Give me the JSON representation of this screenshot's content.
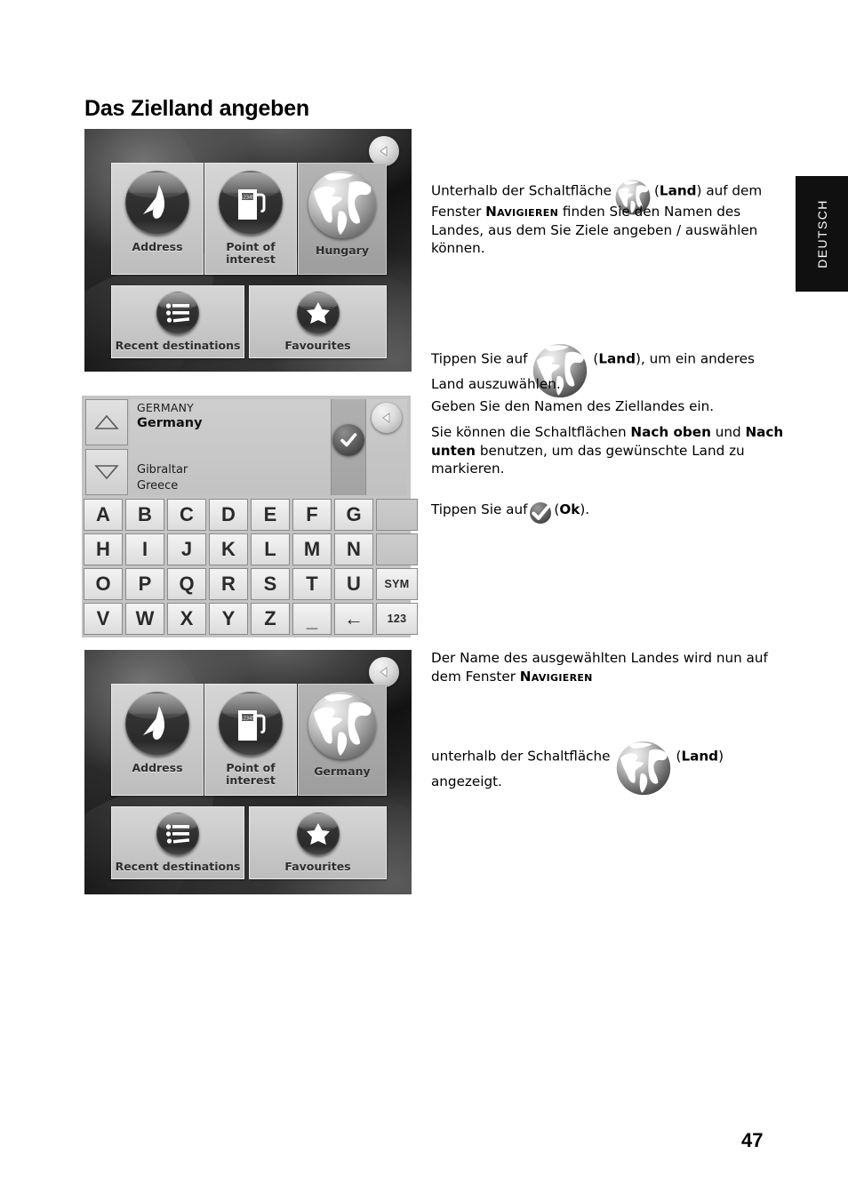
{
  "page": {
    "heading": "Das Zielland angeben",
    "number": "47",
    "language_tab": "DEUTSCH"
  },
  "screenshot_navigate_hungary": {
    "name": "NAVIGIEREN",
    "back_icon": "back-arrow-icon",
    "tiles": [
      {
        "label": "Address",
        "icon": "compass-needle-icon"
      },
      {
        "label": "Point of interest",
        "icon": "fuel-pump-icon"
      },
      {
        "label": "Hungary",
        "icon": "globe-icon"
      },
      {
        "label": "Recent destinations",
        "icon": "list-icon"
      },
      {
        "label": "Favourites",
        "icon": "star-icon"
      }
    ]
  },
  "screenshot_country_picker": {
    "typed_text": "GERMANY",
    "selected_country": "Germany",
    "list_items": [
      "Gibraltar",
      "Greece"
    ],
    "up_button_icon": "triangle-up-icon",
    "down_button_icon": "triangle-down-icon",
    "ok_button_icon": "check-icon",
    "back_icon": "back-arrow-icon",
    "keyboard": {
      "rows": [
        [
          "A",
          "B",
          "C",
          "D",
          "E",
          "F",
          "G",
          ""
        ],
        [
          "H",
          "I",
          "J",
          "K",
          "L",
          "M",
          "N",
          ""
        ],
        [
          "O",
          "P",
          "Q",
          "R",
          "S",
          "T",
          "U",
          "SYM"
        ],
        [
          "V",
          "W",
          "X",
          "Y",
          "Z",
          "_",
          "←",
          "123"
        ]
      ]
    }
  },
  "screenshot_navigate_germany": {
    "name": "NAVIGIEREN",
    "back_icon": "back-arrow-icon",
    "tiles": [
      {
        "label": "Address",
        "icon": "compass-needle-icon"
      },
      {
        "label": "Point of interest",
        "icon": "fuel-pump-icon"
      },
      {
        "label": "Germany",
        "icon": "globe-icon"
      },
      {
        "label": "Recent destinations",
        "icon": "list-icon"
      },
      {
        "label": "Favourites",
        "icon": "star-icon"
      }
    ]
  },
  "body": {
    "p1": {
      "a": "Unterhalb der Schaltfläche",
      "bold1": "Land",
      "b": "auf dem Fenster",
      "sc1": "Navigieren",
      "c": "finden Sie den Namen des Landes, aus dem Sie Ziele angeben / auswählen können."
    },
    "p2": {
      "a": "Tippen Sie auf",
      "bold1": "Land",
      "b": "), um ein anderes Land auszuwählen."
    },
    "p3": "Geben Sie den Namen des Ziellandes ein.",
    "p4": {
      "a": "Sie können die Schaltflächen",
      "bold1": "Nach oben",
      "b": "und",
      "bold2": "Nach unten",
      "c": "benutzen, um das gewünschte Land zu markieren."
    },
    "p5": {
      "a": "Tippen Sie auf",
      "bold1": "Ok",
      "b": ")."
    },
    "p6": {
      "a": "Der Name des ausgewählten Landes wird nun auf dem Fenster",
      "sc1": "Navigieren"
    },
    "p7": {
      "a": "unterhalb der Schaltfläche",
      "bold1": "Land",
      "b": "angezeigt."
    }
  }
}
